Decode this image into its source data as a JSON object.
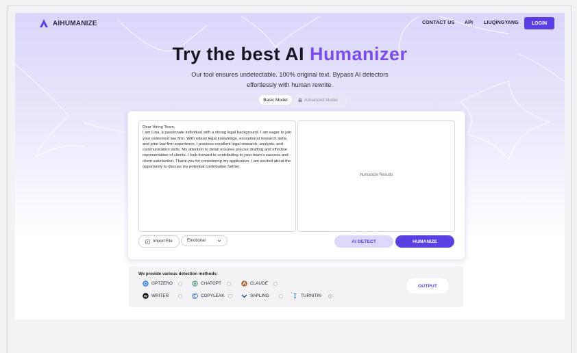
{
  "brand": {
    "name": "AIHUMANIZE",
    "logo_color": "#5b3fe3"
  },
  "nav": {
    "links": [
      "CONTACT US",
      "API",
      "LIUQINGYANG"
    ],
    "login_label": "LOGIN"
  },
  "hero": {
    "title_part1": "Try the best AI ",
    "title_accent": "Humanizer",
    "subtitle": "Our tool ensures undetectable. 100% original text. Bypass AI detectors effortlessly with human rewrite."
  },
  "models": {
    "basic": "Basic Model",
    "advanced": "Advanced Model",
    "selected": "Basic Model"
  },
  "editor": {
    "input_text": "Dear Hiring Team,\nI am Lina, a passionate individual with a strong legal background. I am eager to join your esteemed law firm. With robust legal knowledge, exceptional research skills, and prior law firm experience, I possess excellent legal research, analysis, and communication skills. My attention to detail ensures precise drafting and effective representation of clients. I look forward to contributing to your team's success and client satisfaction. Thank you for considering my application. I am excited about the opportunity to discuss my potential contribution further.",
    "result_placeholder": "Humanize Results",
    "import_label": "Import File",
    "tone_value": "Emotional",
    "detect_label": "AI DETECT",
    "humanize_label": "HUMANIZE"
  },
  "detection": {
    "heading": "We provide various detection methods:",
    "row1": [
      {
        "label": "GPTZERO",
        "icon": "gptzero-icon",
        "color": "#3b82f6"
      },
      {
        "label": "CHATGPT",
        "icon": "chatgpt-icon",
        "color": "#74aa9c"
      },
      {
        "label": "CLAUDE",
        "icon": "claude-icon",
        "color": "#a86a3c"
      }
    ],
    "row2": [
      {
        "label": "WRITER",
        "icon": "writer-icon",
        "color": "#111111"
      },
      {
        "label": "COPYLEAK",
        "icon": "copyleak-icon",
        "color": "#2f6fe0"
      },
      {
        "label": "SAPLING",
        "icon": "sapling-icon",
        "color": "#2a3f8f"
      },
      {
        "label": "TURNITIN",
        "icon": "turnitin-icon",
        "color": "#1e73e8"
      }
    ],
    "output_label": "OUTPUT"
  },
  "colors": {
    "accent": "#5b3fe3",
    "accent_light": "#ddd8fb",
    "title_accent": "#7b4de8"
  }
}
